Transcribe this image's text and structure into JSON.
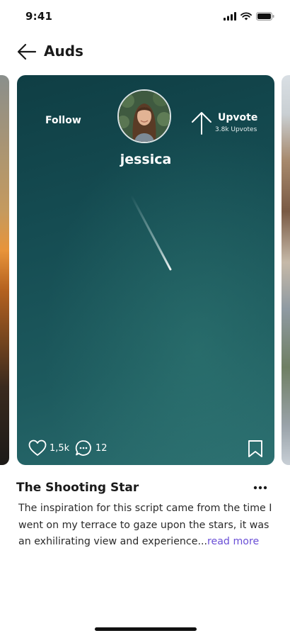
{
  "status_bar": {
    "time": "9:41"
  },
  "header": {
    "title": "Auds",
    "back_icon": "arrow-left-icon"
  },
  "card": {
    "follow_label": "Follow",
    "username": "jessica",
    "upvote_label": "Upvote",
    "upvote_count": "3.8k Upvotes",
    "likes": "1,5k",
    "comments": "12",
    "background_color": "#154c52"
  },
  "post": {
    "title": "The Shooting Star",
    "body": "The inspiration for this script came from the time I went on my terrace to gaze upon the stars, it was an exhilirating view and experience...",
    "read_more": "read more",
    "accent_color": "#6a4fd6"
  }
}
